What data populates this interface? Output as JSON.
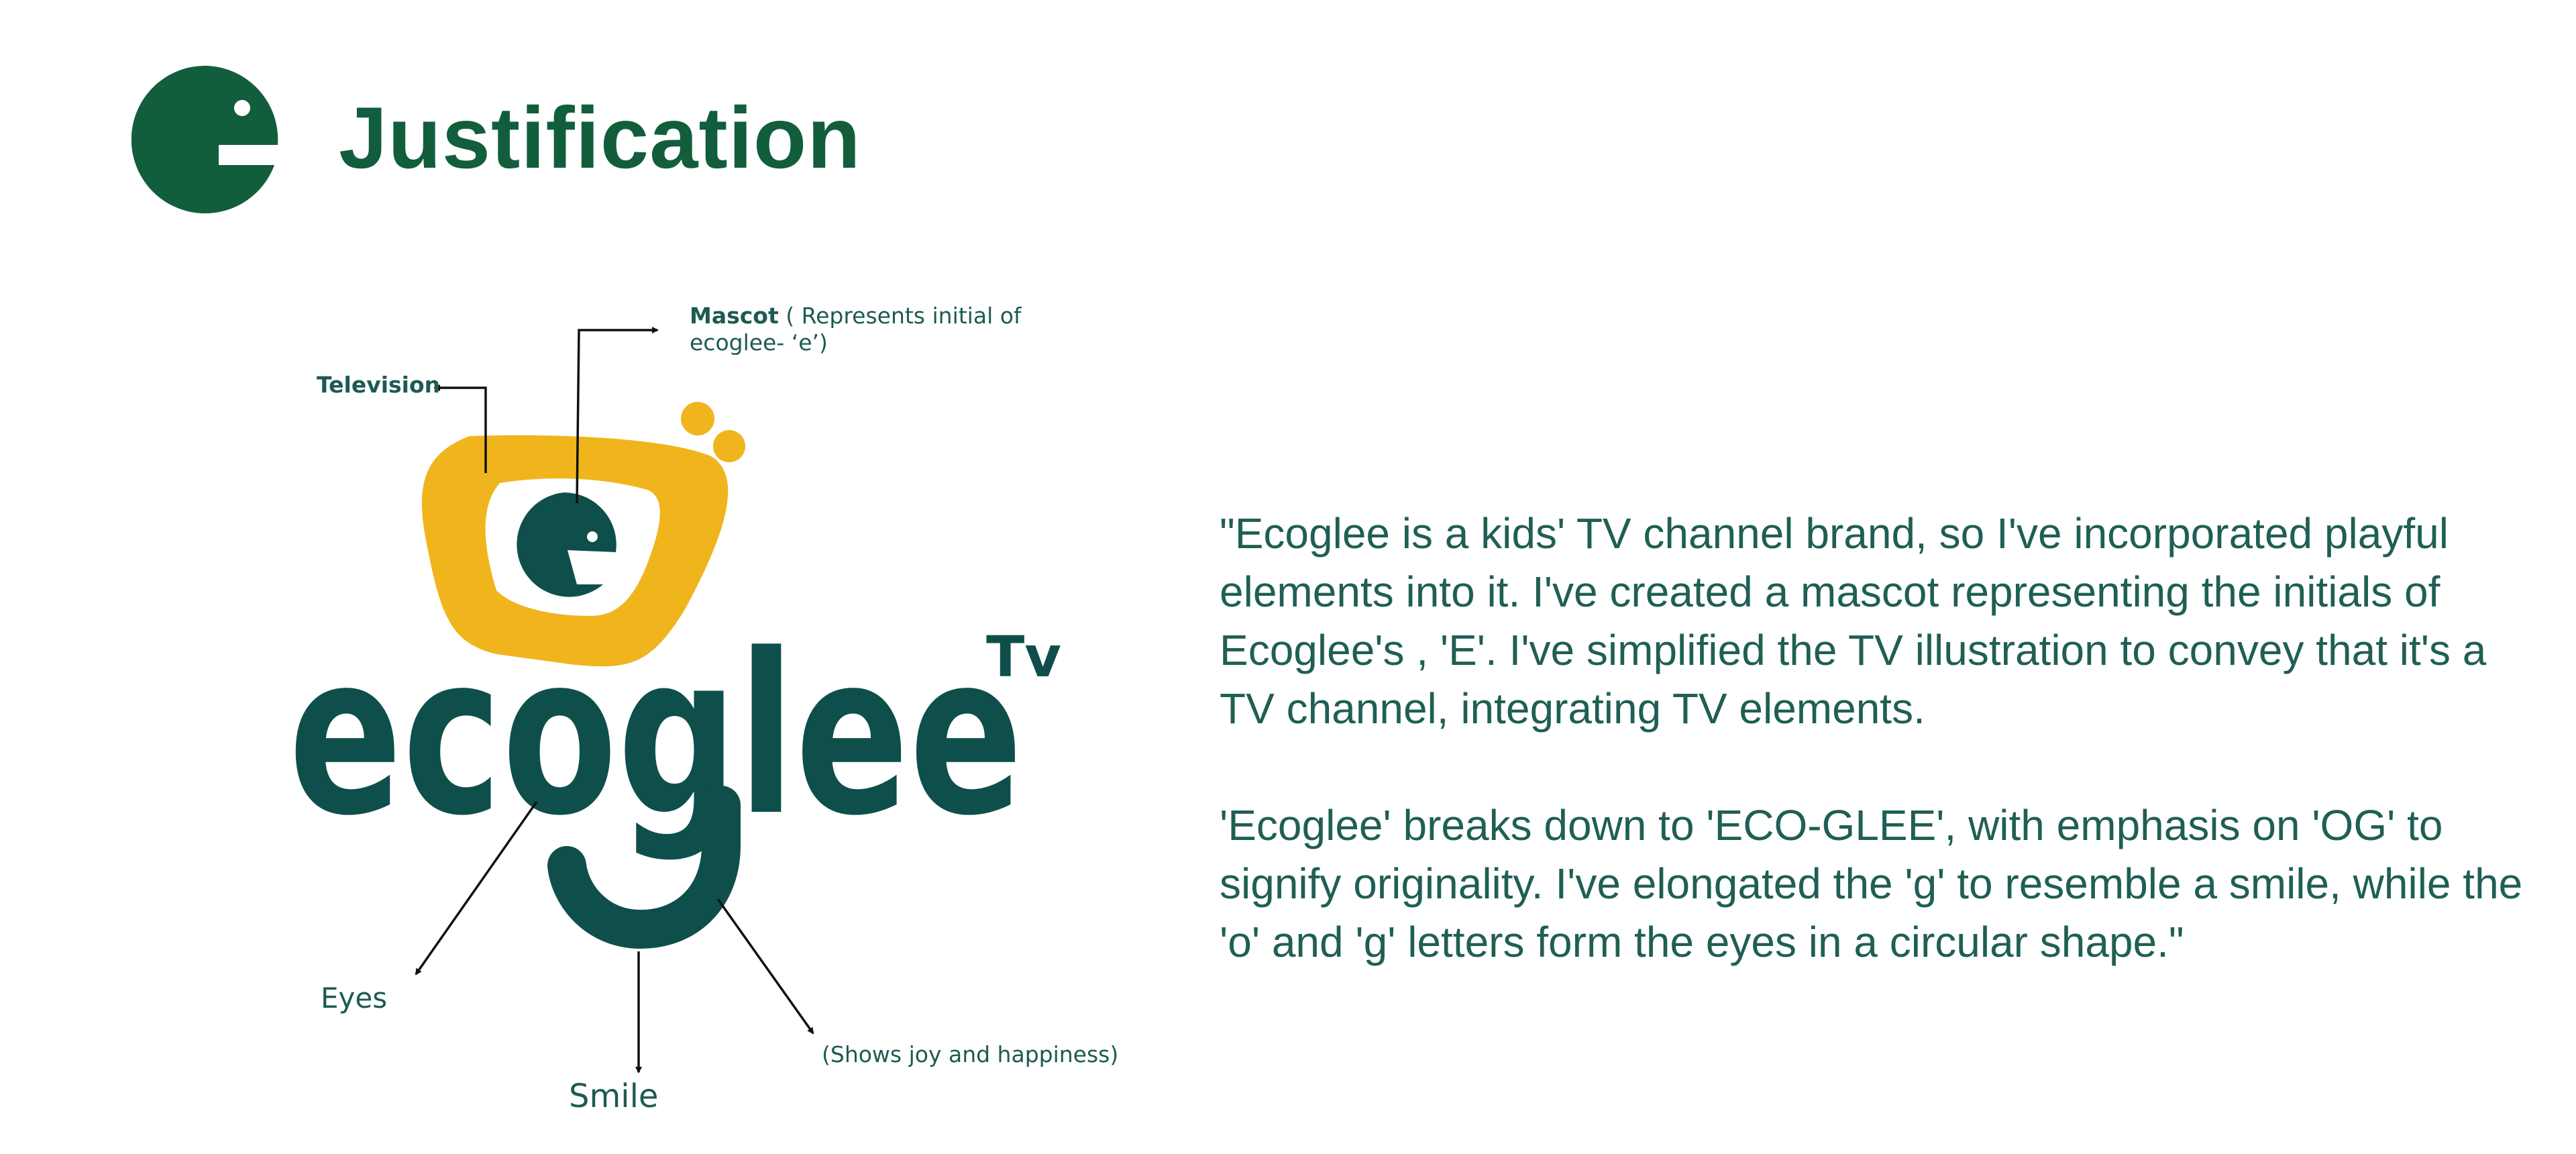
{
  "header": {
    "title": "Justification"
  },
  "diagram": {
    "wordmark": "ecoglee",
    "wordmark_suffix": "Tv",
    "labels": {
      "mascot_bold": "Mascot",
      "mascot_line1": " ( Represents initial of",
      "mascot_line2": "ecoglee- ‘e’)",
      "television": "Television",
      "eyes": "Eyes",
      "smile": "Smile",
      "joy": "(Shows joy and happiness)"
    }
  },
  "description": {
    "paragraph1": "\"Ecoglee is a kids' TV channel brand, so I've incorporated playful elements into it. I've created a mascot representing the initials of Ecoglee's , 'E'. I've simplified the TV illustration to convey that it's a TV channel, integrating TV elements.",
    "paragraph2": "'Ecoglee' breaks down to 'ECO-GLEE', with emphasis on 'OG' to signify originality. I've elongated the 'g' to resemble a smile, while the 'o' and 'g' letters form the eyes in a circular shape.\""
  },
  "colors": {
    "brand_green": "#125e3c",
    "teal": "#0f4f4b",
    "yellow": "#f0b51c",
    "text": "#1f5f54"
  }
}
